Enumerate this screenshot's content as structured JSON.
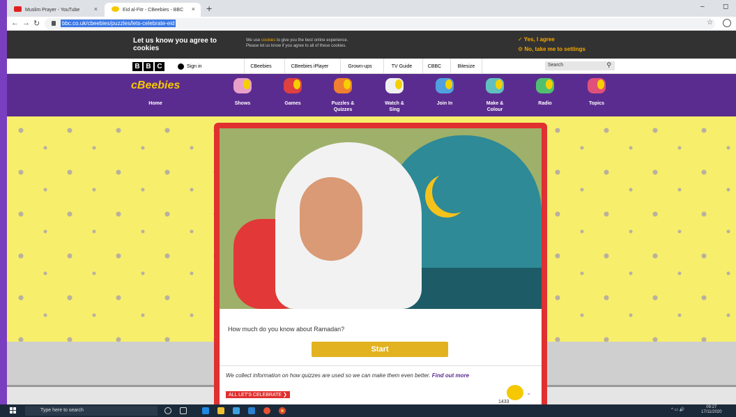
{
  "browser": {
    "tabs": [
      {
        "title": "Muslim Prayer - YouTube",
        "close": "×",
        "color": "#e02020"
      },
      {
        "title": "Eid al-Fitr - CBeebies - BBC",
        "close": "×",
        "color": "#f5c800"
      }
    ],
    "new_tab": "+",
    "url": "bbc.co.uk/cbeebies/puzzles/lets-celebrate-eid",
    "min": "–",
    "max": "◻"
  },
  "cookie": {
    "title": "Let us know you agree to cookies",
    "text_prefix": "We use ",
    "text_link": "cookies",
    "text_suffix": " to give you the best online experience.",
    "text_line2": "Please let us know if you agree to all of these cookies.",
    "yes": "✓ Yes, I agree",
    "no": "⚙ No, take me to settings"
  },
  "bbc": {
    "logo": [
      "B",
      "B",
      "C"
    ],
    "sign_in": "Sign in",
    "nav": [
      "CBeebies",
      "CBeebies iPlayer",
      "Grown-ups",
      "TV Guide",
      "CBBC",
      "Bitesize"
    ],
    "search_placeholder": "Search",
    "search_icon": "🔍"
  },
  "cbeebies": {
    "logo": "cBeebies",
    "home": "Home",
    "items": [
      {
        "label": "Shows",
        "color": "#e8a0c8"
      },
      {
        "label": "Games",
        "color": "#e04040"
      },
      {
        "label": "Puzzles & Quizzes",
        "color": "#f08030"
      },
      {
        "label": "Watch & Sing",
        "color": "#f0f0f0"
      },
      {
        "label": "Join In",
        "color": "#50a0e0"
      },
      {
        "label": "Make & Colour",
        "color": "#60c0c0"
      },
      {
        "label": "Radio",
        "color": "#50c070"
      },
      {
        "label": "Topics",
        "color": "#e0507a"
      }
    ]
  },
  "quiz": {
    "question": "How much do you know about Ramadan?",
    "start": "Start",
    "collect_text": "We collect information on how quizzes are used so we can make them even better.",
    "find_out": "Find out more",
    "ribbon": "ALL LET'S CELEBRATE ❯",
    "chevron": "⌄",
    "number": "1433"
  },
  "taskbar": {
    "search_placeholder": "Type here to search",
    "time": "09:27",
    "date": "17/11/2020"
  }
}
